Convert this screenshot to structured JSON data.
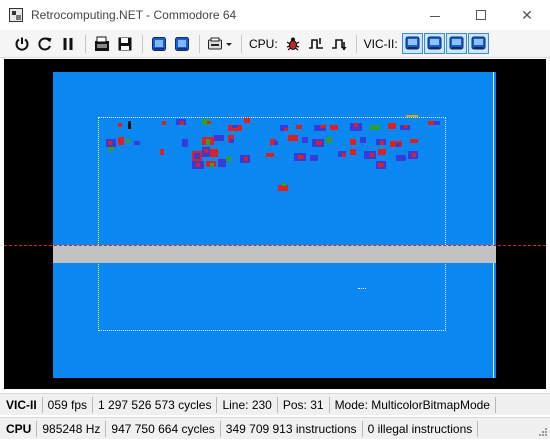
{
  "window": {
    "title": "Retrocomputing.NET - Commodore 64"
  },
  "toolbar": {
    "cpu_label": "CPU:",
    "vic_label": "VIC-II:",
    "icons": [
      "power-icon",
      "reset-icon",
      "pause-icon",
      "load-icon",
      "save-icon",
      "joystick-icon",
      "keyboard-icon",
      "disk-drive-icon",
      "chevron-down-icon",
      "bug-icon",
      "step-over-icon",
      "step-into-icon",
      "vic-mode-icon"
    ]
  },
  "screen": {
    "border_color": "#0a87f0",
    "band_color": "#c2c2c2",
    "raster_color": "#d92020"
  },
  "status_vic": {
    "head": "VIC-II",
    "fps": "059 fps",
    "cycles": "1 297 526 573 cycles",
    "line": "Line: 230",
    "pos": "Pos: 31",
    "mode": "Mode: MulticolorBitmapMode"
  },
  "status_cpu": {
    "head": "CPU",
    "freq": "985248 Hz",
    "cycles": "947 750 664 cycles",
    "instructions": "349 709 913 instructions",
    "illegal": "0 illegal instructions"
  }
}
